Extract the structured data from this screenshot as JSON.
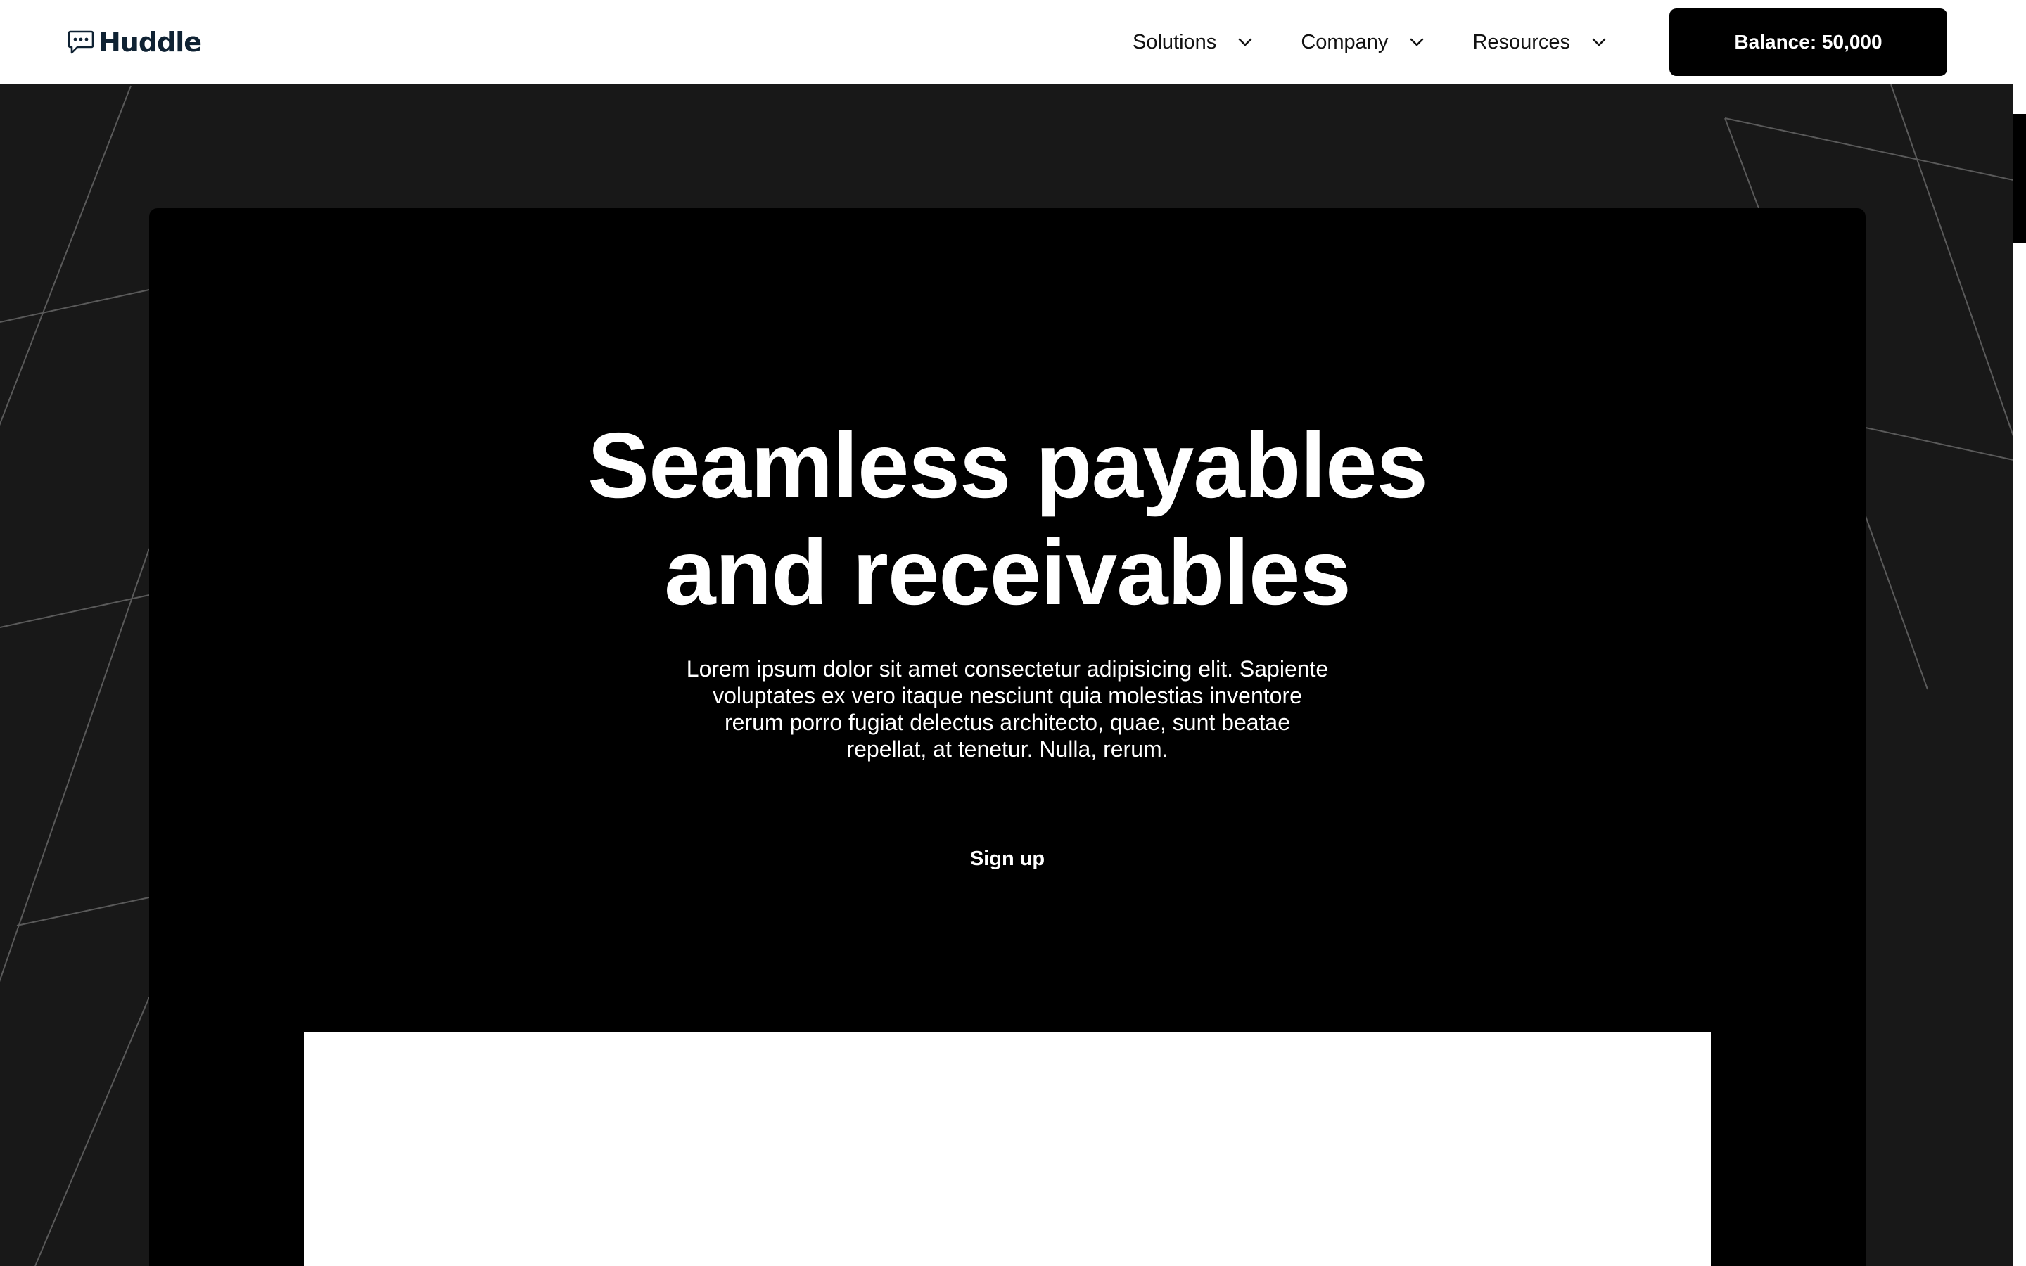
{
  "header": {
    "logo_text": "Huddle",
    "logo_icon": "chat-bubble-icon",
    "nav": [
      {
        "label": "Solutions",
        "icon": "chevron-down-icon"
      },
      {
        "label": "Company",
        "icon": "chevron-down-icon"
      },
      {
        "label": "Resources",
        "icon": "chevron-down-icon"
      }
    ],
    "balance_label": "Balance: 50,000"
  },
  "hero": {
    "title_line1": "Seamless payables",
    "title_line2": "and receivables",
    "subtitle": "Lorem ipsum dolor sit amet consectetur adipisicing elit. Sapiente voluptates ex vero itaque nesciunt quia molestias inventore rerum porro fugiat delectus architecto, quae, sunt beatae repellat, at tenetur. Nulla, rerum.",
    "cta_label": "Sign up"
  },
  "colors": {
    "page_background": "#181818",
    "header_background": "#ffffff",
    "hero_background": "#000000",
    "brand_text": "#0f2233",
    "button_background": "#000000"
  }
}
